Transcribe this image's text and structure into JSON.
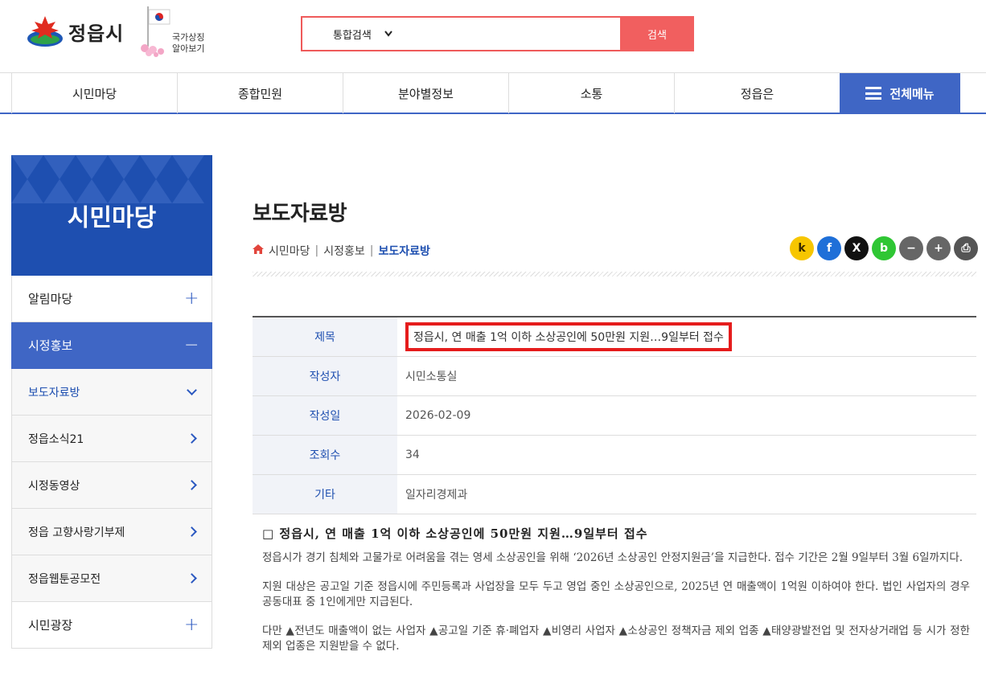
{
  "header": {
    "logo_text": "정읍시",
    "symbol_line1": "국가상징",
    "symbol_line2": "알아보기",
    "search_scope": "통합검색",
    "search_placeholder": "",
    "search_button": "검색"
  },
  "gnb": {
    "items": [
      "시민마당",
      "종합민원",
      "분야별정보",
      "소통",
      "정읍은"
    ],
    "all_menu": "전체메뉴"
  },
  "lnb": {
    "title": "시민마당",
    "items": [
      {
        "label": "알림마당",
        "icon": "plus-icon"
      },
      {
        "label": "시정홍보",
        "icon": "minus-icon"
      },
      {
        "label": "보도자료방",
        "icon": "chevron-down-icon"
      },
      {
        "label": "정읍소식21",
        "icon": "chevron-right-icon"
      },
      {
        "label": "시정동영상",
        "icon": "chevron-right-icon"
      },
      {
        "label": "정읍 고향사랑기부제",
        "icon": "chevron-right-icon"
      },
      {
        "label": "정읍웹툰공모전",
        "icon": "chevron-right-icon"
      },
      {
        "label": "시민광장",
        "icon": "plus-icon"
      }
    ]
  },
  "page": {
    "title": "보도자료방",
    "breadcrumb": [
      "시민마당",
      "시정홍보",
      "보도자료방"
    ]
  },
  "share": [
    {
      "name": "kakaostory-icon",
      "glyph": "k",
      "color": "#f7c600"
    },
    {
      "name": "facebook-icon",
      "glyph": "f",
      "color": "#1e6fd8"
    },
    {
      "name": "x-twitter-icon",
      "glyph": "X",
      "color": "#111111"
    },
    {
      "name": "band-icon",
      "glyph": "b",
      "color": "#2fc634"
    },
    {
      "name": "zoom-out-icon",
      "glyph": "−",
      "color": "#666666"
    },
    {
      "name": "zoom-in-icon",
      "glyph": "+",
      "color": "#666666"
    },
    {
      "name": "print-icon",
      "glyph": "⎙",
      "color": "#555555"
    }
  ],
  "info": {
    "rows": [
      {
        "label": "제목",
        "value": "정읍시, 연 매출 1억 이하 소상공인에 50만원 지원…9일부터 접수"
      },
      {
        "label": "작성자",
        "value": "시민소통실"
      },
      {
        "label": "작성일",
        "value": "2026-02-09"
      },
      {
        "label": "조회수",
        "value": "34"
      },
      {
        "label": "기타",
        "value": "일자리경제과"
      }
    ]
  },
  "article": {
    "heading": "□ 정읍시, 연 매출 1억 이하 소상공인에 50만원 지원…9일부터 접수",
    "p1": "정읍시가 경기 침체와 고물가로 어려움을 겪는 영세 소상공인을 위해 ‘2026년 소상공인 안정지원금’을 지급한다. 접수 기간은 2월 9일부터 3월 6일까지다.",
    "p2": "지원 대상은 공고일 기준 정읍시에 주민등록과 사업장을 모두 두고 영업 중인 소상공인으로, 2025년 연 매출액이 1억원 이하여야 한다. 법인 사업자의 경우 공동대표 중 1인에게만 지급된다.",
    "p3": "다만 ▲전년도 매출액이 없는 사업자 ▲공고일 기준 휴·폐업자 ▲비영리 사업자 ▲소상공인 정책자금 제외 업종 ▲태양광발전업 및 전자상거래업 등 시가 정한 제외 업종은 지원받을 수 없다."
  }
}
